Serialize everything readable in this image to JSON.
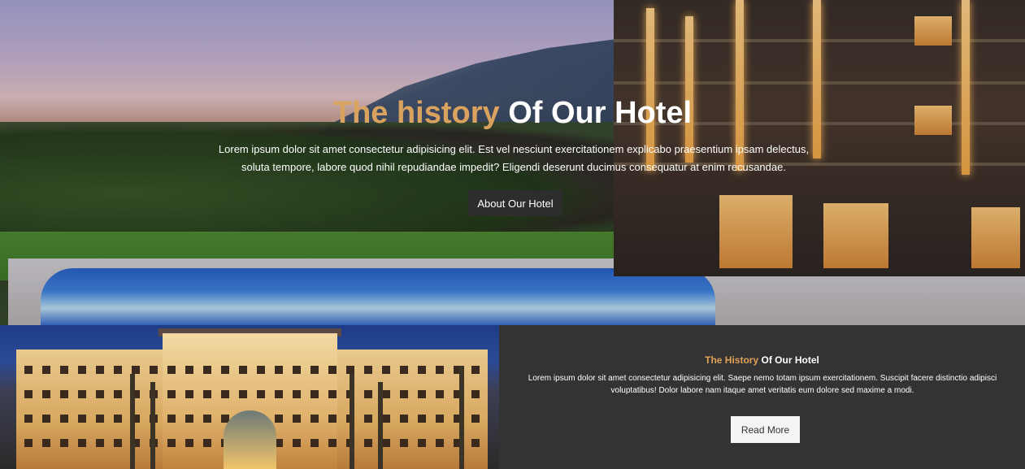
{
  "hero": {
    "title_accent": "The history",
    "title_rest": "Of Our Hotel",
    "text": "Lorem ipsum dolor sit amet consectetur adipisicing elit. Est vel nesciunt exercitationem explicabo praesentium ipsam delectus, soluta tempore, labore quod nihil repudiandae impedit? Eligendi deserunt ducimus consequatur at enim recusandae.",
    "button_label": "About Our Hotel"
  },
  "info": {
    "title_accent": "The History",
    "title_rest": "Of Our Hotel",
    "text": "Lorem ipsum dolor sit amet consectetur adipisicing elit. Saepe nemo totam ipsum exercitationem. Suscipit facere distinctio adipisci voluptatibus! Dolor labore nam itaque amet veritatis eum dolore sed maxime a modi.",
    "button_label": "Read More"
  },
  "colors": {
    "accent": "#d9a35f",
    "panel_background": "#333333",
    "hero_button": "#2d2d2d",
    "read_more_button": "#f4f4f4"
  }
}
